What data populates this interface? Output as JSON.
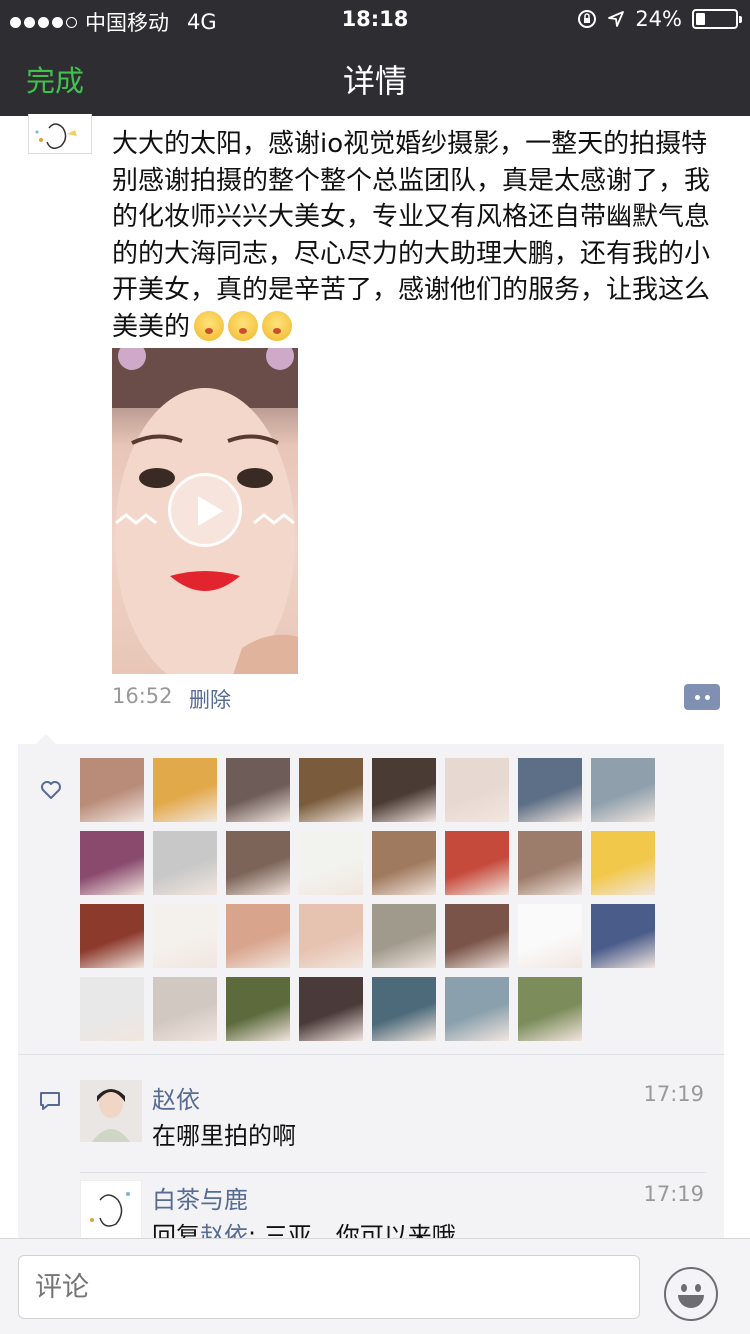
{
  "status_bar": {
    "carrier": "中国移动",
    "network": "4G",
    "time": "18:18",
    "battery": "24%",
    "battery_level": 0.24
  },
  "nav": {
    "done_label": "完成",
    "title": "详情"
  },
  "post": {
    "text": "大大的太阳，感谢io视觉婚纱摄影，一整天的拍摄特别感谢拍摄的整个整个总监团队，真是太感谢了，我的化妆师兴兴大美女，专业又有风格还自带幽默气息的的大海同志，尽心尽力的大助理大鹏，还有我的小开美女，真的是辛苦了，感谢他们的服务，让我这么美美的",
    "emoji_count": 3,
    "time": "16:52",
    "delete_label": "删除"
  },
  "likes": {
    "count": 31,
    "avatar_colors": [
      [
        "#b98c7a",
        "#e2a94a",
        "#6e5c58",
        "#7a5c3c",
        "#4a3c34",
        "#e8d8d2",
        "#5c6f86",
        "#8fa0ac"
      ],
      [
        "#8a4a6e",
        "#c8c8c8",
        "#7c6458",
        "#f2f2ee",
        "#a07a5e",
        "#c64a3c",
        "#9c7c6a",
        "#f2c84a"
      ],
      [
        "#8c3a2c",
        "#f4f0ec",
        "#d8a48c",
        "#e6c2b0",
        "#a09a8c",
        "#7a5448",
        "#fafafa",
        "#4a5c8a"
      ],
      [
        "#e8e8e8",
        "#d2c8c2",
        "#5c6a3c",
        "#4a3a3a",
        "#4c6a7a",
        "#8aa0ac",
        "#7c8c5a"
      ]
    ]
  },
  "comments": [
    {
      "name": "赵依",
      "time": "17:19",
      "text": "在哪里拍的啊"
    },
    {
      "name": "白茶与鹿",
      "time": "17:19",
      "reply_prefix": "回复",
      "reply_to": "赵依",
      "text": ": 三亚，你可以来哦"
    }
  ],
  "input": {
    "placeholder": "评论"
  }
}
